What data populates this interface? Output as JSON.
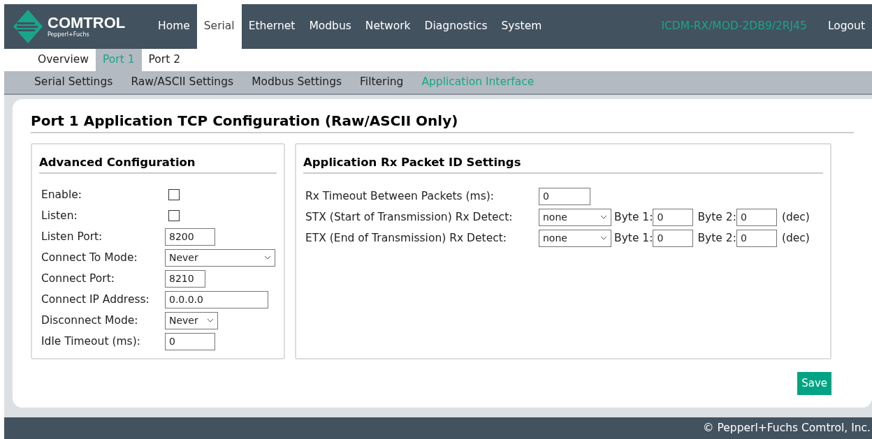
{
  "header": {
    "logo": {
      "name": "COMTROL",
      "tagline": "Pepperl+Fuchs"
    },
    "nav": [
      {
        "label": "Home",
        "selected": false
      },
      {
        "label": "Serial",
        "selected": true
      },
      {
        "label": "Ethernet",
        "selected": false
      },
      {
        "label": "Modbus",
        "selected": false
      },
      {
        "label": "Network",
        "selected": false
      },
      {
        "label": "Diagnostics",
        "selected": false
      },
      {
        "label": "System",
        "selected": false
      }
    ],
    "device": "ICDM-RX/MOD-2DB9/2RJ45",
    "logout": "Logout"
  },
  "port_tabs": [
    {
      "label": "Overview",
      "selected": false
    },
    {
      "label": "Port 1",
      "selected": true
    },
    {
      "label": "Port 2",
      "selected": false
    }
  ],
  "sub_tabs": [
    {
      "label": "Serial Settings",
      "selected": false
    },
    {
      "label": "Raw/ASCII Settings",
      "selected": false
    },
    {
      "label": "Modbus Settings",
      "selected": false
    },
    {
      "label": "Filtering",
      "selected": false
    },
    {
      "label": "Application Interface",
      "selected": true
    }
  ],
  "page_title": "Port 1 Application TCP Configuration (Raw/ASCII Only)",
  "advanced": {
    "title": "Advanced Configuration",
    "fields": [
      {
        "kind": "checkbox",
        "label": "Enable:",
        "checked": false
      },
      {
        "kind": "checkbox",
        "label": "Listen:",
        "checked": false
      },
      {
        "kind": "input",
        "label": "Listen Port:",
        "value": "8200"
      },
      {
        "kind": "select",
        "label": "Connect To Mode:",
        "value": "Never"
      },
      {
        "kind": "input",
        "label": "Connect Port:",
        "value": "8210"
      },
      {
        "kind": "input",
        "label": "Connect IP Address:",
        "value": "0.0.0.0"
      },
      {
        "kind": "select",
        "label": "Disconnect Mode:",
        "value": "Never"
      },
      {
        "kind": "input",
        "label": "Idle Timeout (ms):",
        "value": "0"
      }
    ]
  },
  "rx": {
    "title": "Application Rx Packet ID Settings",
    "timeout": {
      "label": "Rx Timeout Between Packets (ms):",
      "value": "0"
    },
    "detects": [
      {
        "label": "STX (Start of Transmission) Rx Detect:",
        "mode": "none",
        "byte1_label": "Byte 1:",
        "byte1": "0",
        "byte2_label": "Byte 2:",
        "byte2": "0",
        "unit": "(dec)"
      },
      {
        "label": "ETX (End of Transmission) Rx Detect:",
        "mode": "none",
        "byte1_label": "Byte 1:",
        "byte1": "0",
        "byte2_label": "Byte 2:",
        "byte2": "0",
        "unit": "(dec)"
      }
    ]
  },
  "save": "Save",
  "footer": "© Pepperl+Fuchs Comtrol, Inc."
}
